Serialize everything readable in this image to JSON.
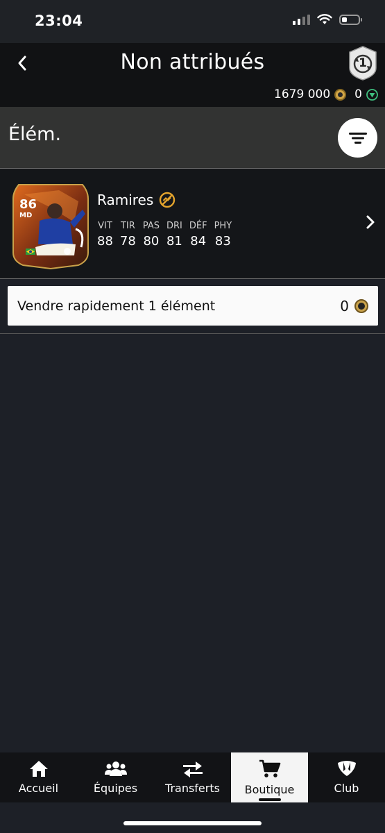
{
  "status_bar": {
    "time": "23:04",
    "battery_level": 0.3
  },
  "header": {
    "back_icon": "chevron-left-icon",
    "title": "Non attribués",
    "objectives_icon": "objectives-badge-icon",
    "objectives_count": "1",
    "coins": "1679 000",
    "points": "0"
  },
  "section": {
    "title": "Élém.",
    "filter_icon": "filter-icon"
  },
  "player": {
    "rating": "86",
    "position": "MD",
    "name": "Ramires",
    "badge_icon": "untradeable-icon",
    "stats": [
      {
        "label": "VIT",
        "value": "88"
      },
      {
        "label": "TIR",
        "value": "78"
      },
      {
        "label": "PAS",
        "value": "80"
      },
      {
        "label": "DRI",
        "value": "81"
      },
      {
        "label": "DÉF",
        "value": "84"
      },
      {
        "label": "PHY",
        "value": "83"
      }
    ]
  },
  "quick_sell": {
    "label": "Vendre rapidement 1 élément",
    "price": "0"
  },
  "tabs": [
    {
      "label": "Accueil",
      "icon": "home-icon",
      "active": false
    },
    {
      "label": "Équipes",
      "icon": "people-icon",
      "active": false
    },
    {
      "label": "Transferts",
      "icon": "transfer-arrows-icon",
      "active": false
    },
    {
      "label": "Boutique",
      "icon": "cart-icon",
      "active": true
    },
    {
      "label": "Club",
      "icon": "club-icon",
      "active": false
    }
  ],
  "colors": {
    "accent_gold": "#d2a647",
    "background": "#1d2027",
    "header": "#111214"
  }
}
